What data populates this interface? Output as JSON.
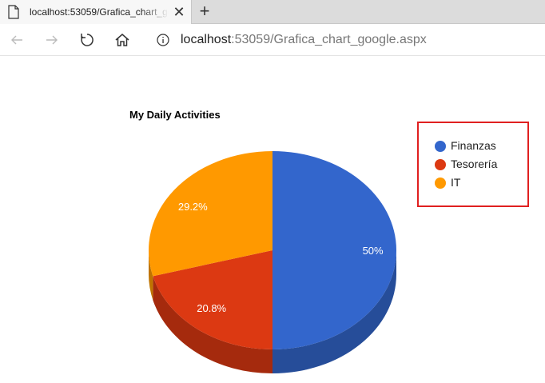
{
  "browser": {
    "tab": {
      "title": "localhost:53059/Grafica_chart_google.aspx",
      "close_glyph": "✕"
    },
    "new_tab_glyph": "+",
    "address": {
      "host": "localhost",
      "path": ":53059/Grafica_chart_google.aspx"
    },
    "icons": [
      "page-icon",
      "back-icon",
      "forward-icon",
      "refresh-icon",
      "home-icon",
      "info-icon"
    ]
  },
  "chart_data": {
    "type": "pie",
    "title": "My Daily Activities",
    "is3D": true,
    "legend_position": "right",
    "categories": [
      "Finanzas",
      "Tesorería",
      "IT"
    ],
    "values": [
      50,
      20.8,
      29.2
    ],
    "labels": [
      "50%",
      "20.8%",
      "29.2%"
    ],
    "colors": [
      "#3366cc",
      "#dc3912",
      "#ff9900"
    ],
    "side_colors": [
      "#264d99",
      "#a52a0d",
      "#bf7300"
    ]
  }
}
